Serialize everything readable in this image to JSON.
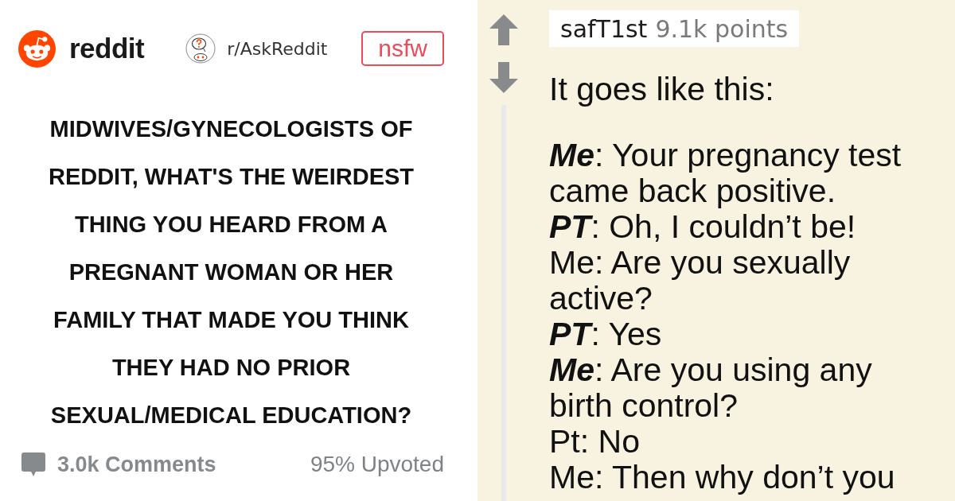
{
  "post": {
    "site": {
      "wordmark": "reddit"
    },
    "subreddit": "r/AskReddit",
    "badge": "nsfw",
    "title": "MIDWIVES/GYNECOLOGISTS OF REDDIT, WHAT'S THE WEIRDEST THING YOU HEARD FROM A PREGNANT WOMAN OR HER FAMILY THAT MADE YOU THINK THEY HAD NO PRIOR SEXUAL/MEDICAL EDUCATION?",
    "comments": "3.0k Comments",
    "upvoted": "95% Upvoted"
  },
  "comment": {
    "author": "safT1st",
    "score": "9.1k points",
    "paragraphs": [
      {
        "lines": [
          "It goes like this:"
        ]
      },
      {
        "lines": [
          "*Me*: Your pregnancy test came back positive.",
          "*PT*: Oh, I couldn’t be!",
          "Me: Are you sexually active?",
          "*PT*: Yes",
          "*Me*: Are you using any birth control?",
          "Pt: No",
          "Me: Then why don’t you"
        ]
      }
    ]
  }
}
